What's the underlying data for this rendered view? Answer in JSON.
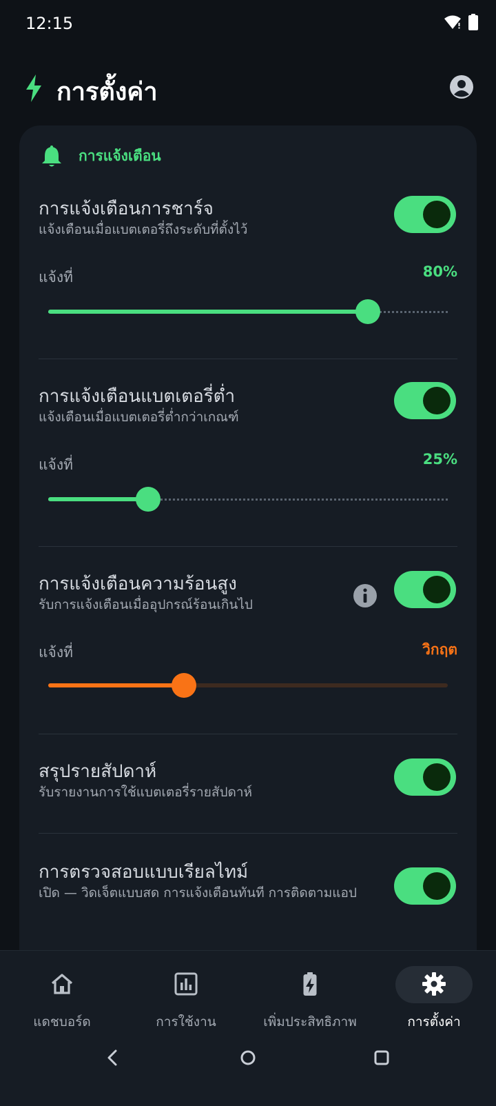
{
  "status": {
    "time": "12:15"
  },
  "header": {
    "title": "การตั้งค่า"
  },
  "section": {
    "title": "การแจ้งเตือน"
  },
  "charge": {
    "title": "การแจ้งเตือนการชาร์จ",
    "subtitle": "แจ้งเตือนเมื่อแบตเตอรี่ถึงระดับที่ตั้งไว้",
    "label": "แจ้งที่",
    "value": "80%",
    "level": 0.8,
    "enabled": true
  },
  "low": {
    "title": "การแจ้งเตือนแบตเตอรี่ต่ำ",
    "subtitle": "แจ้งเตือนเมื่อแบตเตอรี่ต่ำกว่าเกณฑ์",
    "label": "แจ้งที่",
    "value": "25%",
    "level": 0.25,
    "enabled": true
  },
  "heat": {
    "title": "การแจ้งเตือนความร้อนสูง",
    "subtitle": "รับการแจ้งเตือนเมื่ออุปกรณ์ร้อนเกินไป",
    "label": "แจ้งที่",
    "value": "วิกฤต",
    "level": 0.34,
    "enabled": true
  },
  "weekly": {
    "title": "สรุปรายสัปดาห์",
    "subtitle": "รับรายงานการใช้แบตเตอรี่รายสัปดาห์",
    "enabled": true
  },
  "realtime": {
    "title": "การตรวจสอบแบบเรียลไทม์",
    "subtitle": "เปิด — วิดเจ็ตแบบสด การแจ้งเตือนทันที การติดตามแอป",
    "enabled": true
  },
  "nav": {
    "items": [
      {
        "label": "แดชบอร์ด",
        "icon": "home-icon"
      },
      {
        "label": "การใช้งาน",
        "icon": "bar-chart-icon"
      },
      {
        "label": "เพิ่มประสิทธิภาพ",
        "icon": "battery-bolt-icon"
      },
      {
        "label": "การตั้งค่า",
        "icon": "gear-icon",
        "active": true
      }
    ]
  },
  "colors": {
    "accent": "#4ade80",
    "hot": "#f97316",
    "background": "#0e1217",
    "card": "#161c24"
  }
}
